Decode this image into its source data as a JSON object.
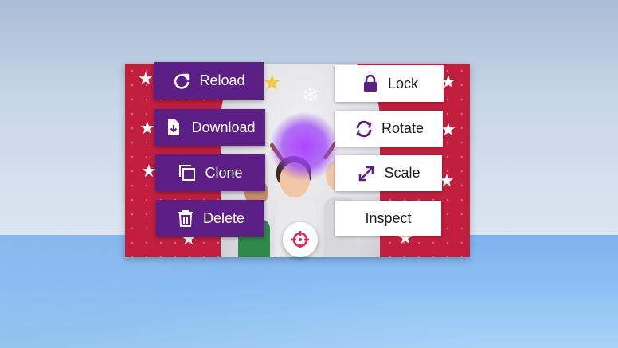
{
  "scene": {
    "sky_color": "#c7d6e8",
    "ground_color": "#8cc0f3"
  },
  "card": {
    "background_color": "#c21f3f",
    "accent_color": "#5b1f86"
  },
  "menu": {
    "left": [
      {
        "label": "Reload",
        "icon": "reload-icon"
      },
      {
        "label": "Download",
        "icon": "download-icon"
      },
      {
        "label": "Clone",
        "icon": "clone-icon"
      },
      {
        "label": "Delete",
        "icon": "trash-icon"
      }
    ],
    "right": [
      {
        "label": "Lock",
        "icon": "lock-icon"
      },
      {
        "label": "Rotate",
        "icon": "rotate-icon"
      },
      {
        "label": "Scale",
        "icon": "scale-icon"
      },
      {
        "label": "Inspect",
        "icon": ""
      }
    ],
    "focus_button": {
      "icon": "crosshair-icon",
      "color": "#e0245e"
    }
  }
}
